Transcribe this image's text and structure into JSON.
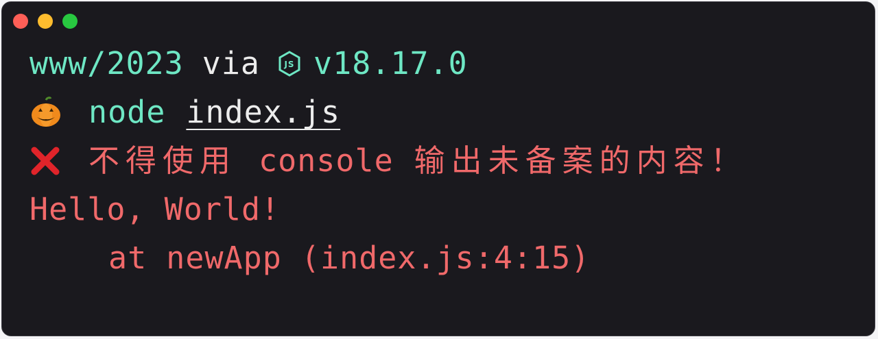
{
  "window": {
    "traffic_lights": [
      "close",
      "minimize",
      "maximize"
    ],
    "colors": {
      "background": "#1a191e",
      "prompt": "#6ee7c4",
      "text": "#ececec",
      "error": "#f0696a"
    }
  },
  "prompt": {
    "directory": "www/2023",
    "via_word": "via",
    "runtime_icon": "nodejs-icon",
    "runtime_version": "v18.17.0"
  },
  "command": {
    "prompt_icon": "pumpkin-icon",
    "program": "node",
    "argument": "index.js"
  },
  "output": {
    "error_icon": "cross-mark-icon",
    "error_message_zh_1": "不得使用",
    "error_message_code": "console",
    "error_message_zh_2": "输出未备案的内容！",
    "log_text": "Hello, World!",
    "stack_trace": "at newApp (index.js:4:15)"
  }
}
